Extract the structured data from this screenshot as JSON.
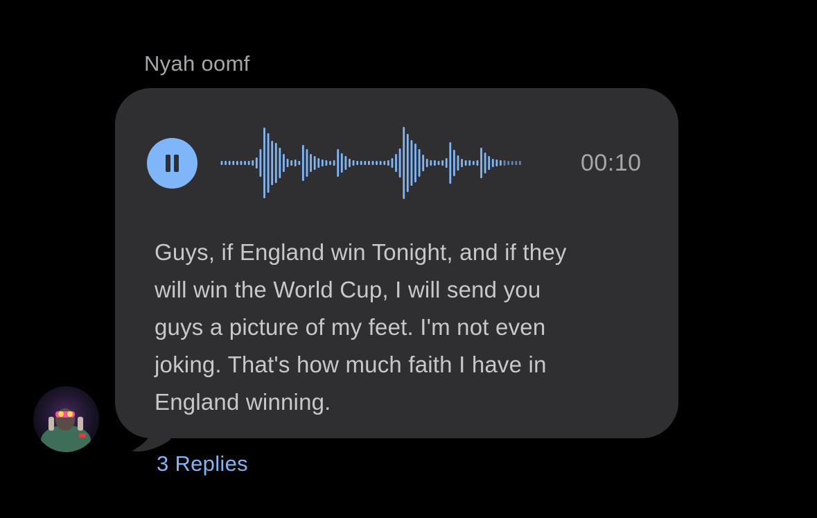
{
  "message": {
    "sender_name": "Nyah oomf",
    "voice_note": {
      "state": "playing",
      "control_icon": "pause-icon",
      "duration": "00:10",
      "accent_color": "#7fb6f7"
    },
    "transcript": "Guys, if England win Tonight, and if they\nwill win the World Cup, I will send you\nguys a picture of my feet. I'm not even\njoking. That's how much faith I have in\nEngland winning.",
    "replies_label": "3 Replies",
    "bubble_color": "#2f2f32"
  }
}
